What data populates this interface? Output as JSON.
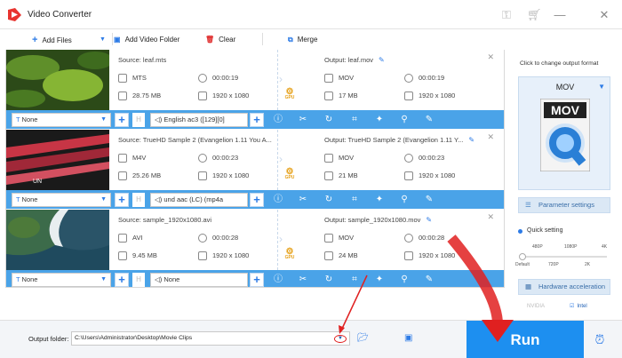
{
  "window": {
    "title": "Video Converter"
  },
  "toolbar": {
    "add_files": "Add Files",
    "add_video_folder": "Add Video Folder",
    "clear": "Clear",
    "merge": "Merge"
  },
  "files": [
    {
      "source": "Source: leaf.mts",
      "src_format": "MTS",
      "src_duration": "00:00:19",
      "src_size": "28.75 MB",
      "src_resolution": "1920 x 1080",
      "output": "Output: leaf.mov",
      "out_format": "MOV",
      "out_duration": "00:00:19",
      "out_size": "17 MB",
      "out_resolution": "1920 x 1080",
      "subtitle": "None",
      "audio": "English ac3 ([129][0]"
    },
    {
      "source": "Source: TrueHD Sample 2 (Evangelion 1.11 You A...",
      "src_format": "M4V",
      "src_duration": "00:00:23",
      "src_size": "25.26 MB",
      "src_resolution": "1920 x 1080",
      "output": "Output: TrueHD Sample 2 (Evangelion 1.11 Y...",
      "out_format": "MOV",
      "out_duration": "00:00:23",
      "out_size": "21 MB",
      "out_resolution": "1920 x 1080",
      "subtitle": "None",
      "audio": "und aac (LC) (mp4a"
    },
    {
      "source": "Source: sample_1920x1080.avi",
      "src_format": "AVI",
      "src_duration": "00:00:28",
      "src_size": "9.45 MB",
      "src_resolution": "1920 x 1080",
      "output": "Output: sample_1920x1080.mov",
      "out_format": "MOV",
      "out_duration": "00:00:28",
      "out_size": "24 MB",
      "out_resolution": "1920 x 1080",
      "subtitle": "None",
      "audio": "None"
    }
  ],
  "gpu_label": "GPU",
  "right_panel": {
    "title": "Click to change output format",
    "format": "MOV",
    "format_icon_text": "MOV",
    "parameter_settings": "Parameter settings",
    "quick_setting": "Quick setting",
    "quality_top": [
      "480P",
      "1080P",
      "4K"
    ],
    "quality_bottom": [
      "Default",
      "720P",
      "2K"
    ],
    "hardware_acceleration": "Hardware acceleration",
    "nvidia": "NVIDIA",
    "intel": "Intel"
  },
  "bottom": {
    "output_folder_label": "Output folder:",
    "output_folder_value": "C:\\Users\\Administrator\\Desktop\\Movie Clips",
    "run": "Run"
  },
  "colors": {
    "accent": "#4aa3e8",
    "run": "#1d8ff0",
    "annotation": "#e02020"
  }
}
